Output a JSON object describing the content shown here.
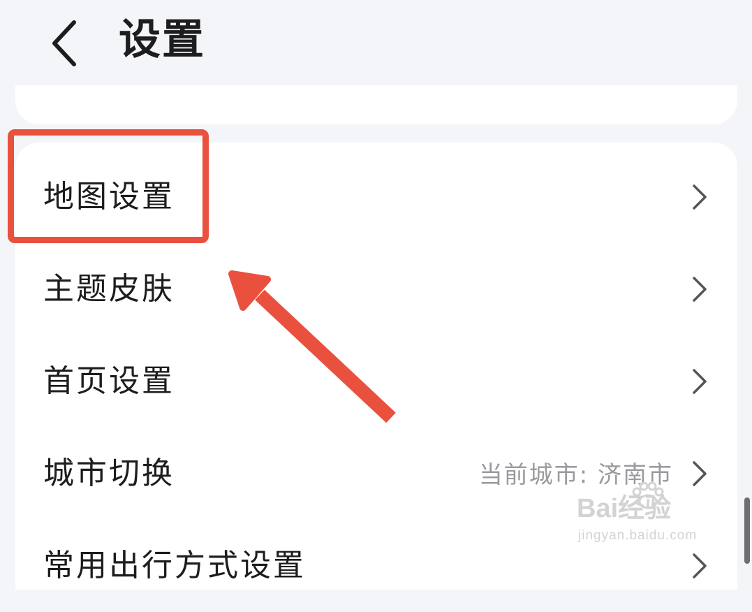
{
  "header": {
    "title": "设置",
    "back_icon": "chevron-left-icon"
  },
  "settings": {
    "items": [
      {
        "label": "地图设置",
        "value": ""
      },
      {
        "label": "主题皮肤",
        "value": ""
      },
      {
        "label": "首页设置",
        "value": ""
      },
      {
        "label": "城市切换",
        "value": "当前城市: 济南市"
      },
      {
        "label": "常用出行方式设置",
        "value": ""
      }
    ]
  },
  "annotation": {
    "color": "#e9513e"
  },
  "watermark": {
    "brand": "Bai经验",
    "url": "jingyan.baidu.com"
  }
}
